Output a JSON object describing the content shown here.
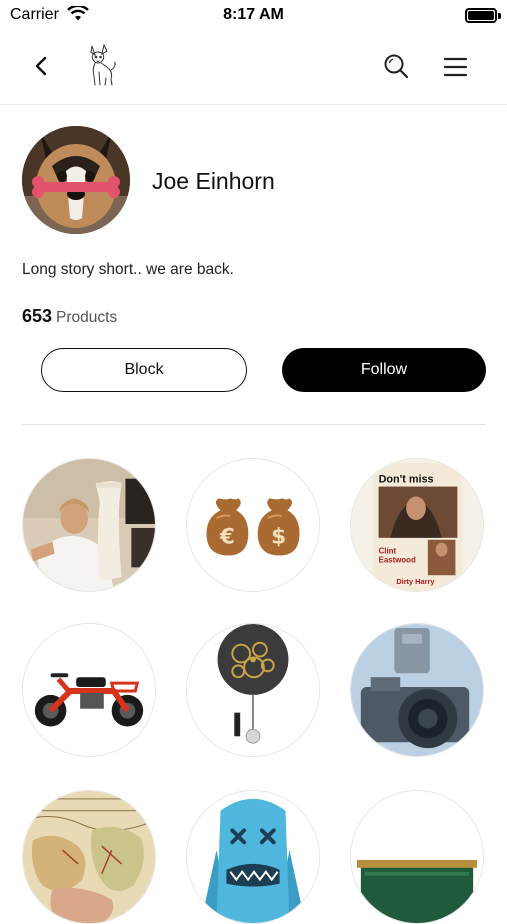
{
  "status_bar": {
    "carrier": "Carrier",
    "time": "8:17 AM"
  },
  "nav": {
    "back_icon": "chevron-left-icon",
    "logo_icon": "dog-logo-icon",
    "search_icon": "search-icon",
    "menu_icon": "hamburger-menu-icon"
  },
  "profile": {
    "name": "Joe Einhorn",
    "bio": "Long story short.. we are back.",
    "product_count": "653",
    "product_label": "Products",
    "block_label": "Block",
    "follow_label": "Follow"
  },
  "products": [
    {
      "name": "person-with-vase"
    },
    {
      "name": "money-bags-euro-dollar",
      "glyphs": [
        "€",
        "$"
      ]
    },
    {
      "name": "dirty-harry-poster",
      "texts": [
        "Don't miss",
        "Clint",
        "Eastwood",
        "Dirty Harry"
      ]
    },
    {
      "name": "mini-bike"
    },
    {
      "name": "gear-pendulum-clock"
    },
    {
      "name": "vintage-camera"
    },
    {
      "name": "antique-map"
    },
    {
      "name": "kaws-figure"
    },
    {
      "name": "green-box"
    }
  ]
}
